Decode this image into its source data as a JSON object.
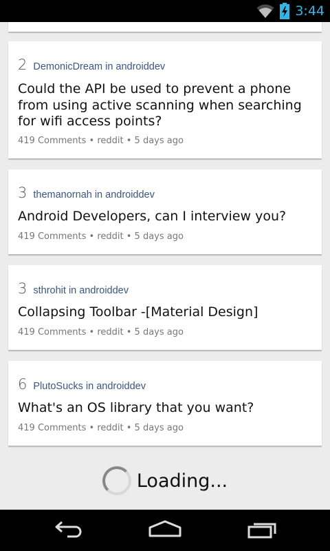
{
  "status_bar": {
    "time": "3:44",
    "icons": [
      "wifi-icon",
      "battery-charging-icon"
    ],
    "accent_color": "#33b5e5"
  },
  "posts": [
    {
      "score": "2",
      "author": "DemonicDream",
      "in_word": "in",
      "subreddit": "androiddev",
      "title": "Could the API be used to prevent a phone from using active scanning when searching for wifi access points?",
      "footer": "419 Comments • reddit • 5 days ago"
    },
    {
      "score": "3",
      "author": "themanornah",
      "in_word": "in",
      "subreddit": "androiddev",
      "title": "Android Developers, can I interview you?",
      "footer": "419 Comments • reddit • 5 days ago"
    },
    {
      "score": "3",
      "author": "sthrohit",
      "in_word": "in",
      "subreddit": "androiddev",
      "title": "Collapsing Toolbar -[Material Design]",
      "footer": "419 Comments • reddit • 5 days ago"
    },
    {
      "score": "6",
      "author": "PlutoSucks",
      "in_word": "in",
      "subreddit": "androiddev",
      "title": "What's an OS library that you want?",
      "footer": "419 Comments • reddit • 5 days ago"
    }
  ],
  "loading": {
    "text": "Loading..."
  },
  "nav_bar": {
    "buttons": [
      "back-icon",
      "home-icon",
      "recent-apps-icon"
    ]
  },
  "colors": {
    "background": "#ececec",
    "card": "#ffffff",
    "author_link": "#3b5584",
    "meta_text": "#777777"
  }
}
